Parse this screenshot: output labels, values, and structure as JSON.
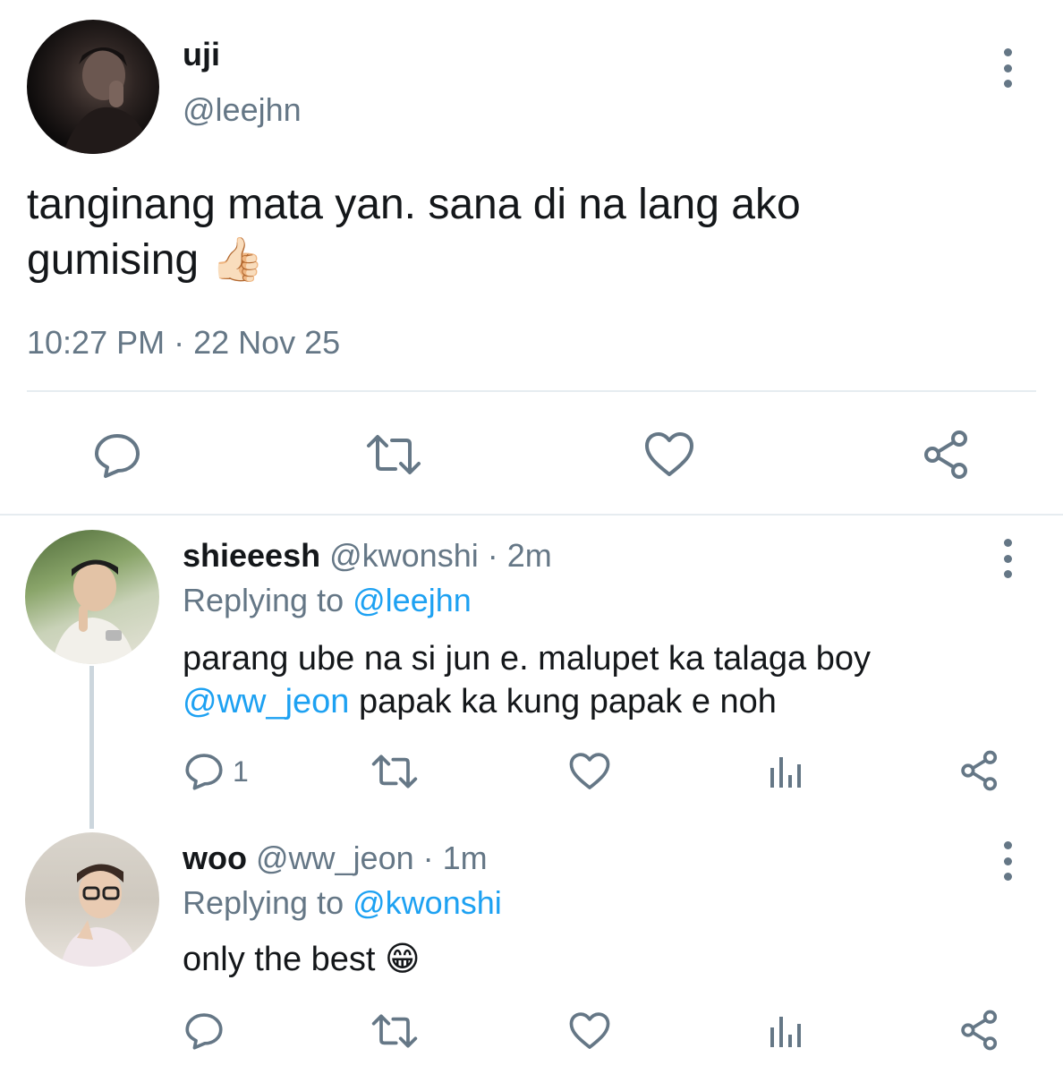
{
  "main_tweet": {
    "display_name": "uji",
    "handle": "@leejhn",
    "text": "tanginang mata yan. sana di na lang ako gumising",
    "emoji": "👍🏻",
    "timestamp": "10:27 PM · 22 Nov 25"
  },
  "replies": [
    {
      "display_name": "shieeesh",
      "handle": "@kwonshi",
      "time": "· 2m",
      "replying_prefix": "Replying to",
      "replying_to": "@leejhn",
      "text_line1": "parang ube na si jun e. malupet ka talaga boy",
      "mention": "@ww_jeon",
      "text_line2": "papak ka kung papak e noh",
      "reply_count": "1"
    },
    {
      "display_name": "woo",
      "handle": "@ww_jeon",
      "time": "· 1m",
      "replying_prefix": "Replying to",
      "replying_to": "@kwonshi",
      "text": "only the best",
      "emoji": "😁"
    }
  ],
  "colors": {
    "text": "#14171a",
    "secondary": "#657786",
    "accent": "#1da1f2",
    "divider": "#e6ecf0"
  },
  "icons": [
    "reply-icon",
    "retweet-icon",
    "like-icon",
    "share-icon",
    "analytics-icon",
    "more-icon"
  ]
}
